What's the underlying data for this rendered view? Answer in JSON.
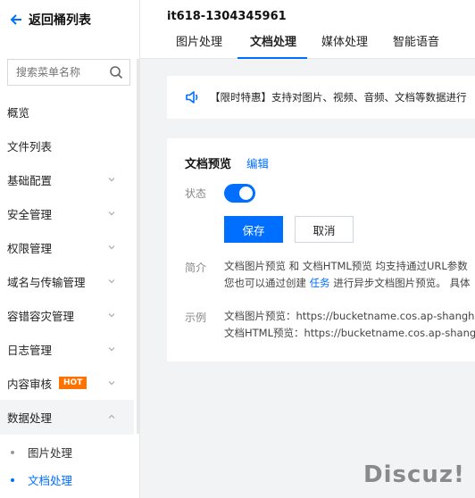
{
  "sidebar": {
    "back_label": "返回桶列表",
    "search_placeholder": "搜索菜单名称",
    "items": [
      {
        "label": "概览"
      },
      {
        "label": "文件列表"
      },
      {
        "label": "基础配置"
      },
      {
        "label": "安全管理"
      },
      {
        "label": "权限管理"
      },
      {
        "label": "域名与传输管理"
      },
      {
        "label": "容错容灾管理"
      },
      {
        "label": "日志管理"
      },
      {
        "label": "内容审核",
        "badge": "HOT"
      },
      {
        "label": "数据处理"
      }
    ],
    "sub_items": [
      {
        "label": "图片处理"
      },
      {
        "label": "文档处理"
      }
    ]
  },
  "header": {
    "bucket_name": "it618-1304345961",
    "tabs": [
      {
        "label": "图片处理"
      },
      {
        "label": "文档处理"
      },
      {
        "label": "媒体处理"
      },
      {
        "label": "智能语音"
      }
    ]
  },
  "notice": {
    "text": "【限时特惠】支持对图片、视频、音频、文档等数据进行"
  },
  "card": {
    "title": "文档预览",
    "edit_label": "编辑",
    "status_label": "状态",
    "status_on": true,
    "save_label": "保存",
    "cancel_label": "取消",
    "intro_label": "简介",
    "intro_line1": "文档图片预览 和 文档HTML预览 均支持通过URL参数",
    "intro_line2_pre": "您也可以通过创建 ",
    "intro_line2_link": "任务",
    "intro_line2_post": " 进行异步文档图片预览。 具体",
    "example_label": "示例",
    "example_line1": "文档图片预览：https://bucketname.cos.ap-shanghai.",
    "example_line2": "文档HTML预览：https://bucketname.cos.ap-shangha"
  },
  "watermark": "Discuz!",
  "colors": {
    "accent": "#006eff",
    "hot_badge": "#ff7200",
    "background": "#f2f3f5"
  }
}
